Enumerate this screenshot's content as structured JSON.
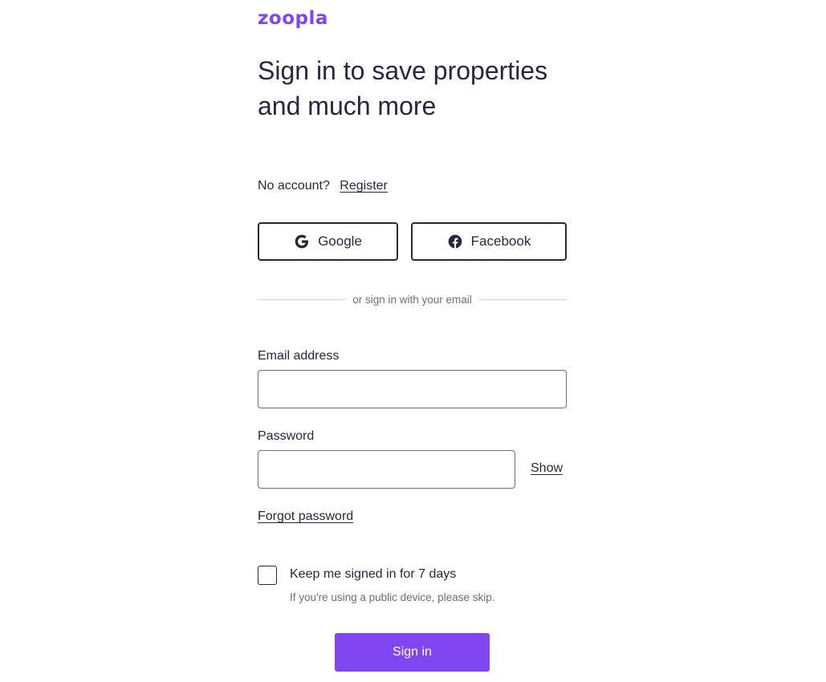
{
  "brand": {
    "logo_text": "zoopla",
    "accent_color": "#8046f1"
  },
  "headline": "Sign in to save properties and much more",
  "register_prompt": {
    "text": "No account?",
    "link": "Register"
  },
  "social": {
    "google": {
      "label": "Google",
      "icon": "google-icon"
    },
    "facebook": {
      "label": "Facebook",
      "icon": "facebook-icon"
    }
  },
  "divider_text": "or sign in with your email",
  "form": {
    "email": {
      "label": "Email address",
      "value": "",
      "placeholder": ""
    },
    "password": {
      "label": "Password",
      "value": "",
      "placeholder": "",
      "show_label": "Show"
    },
    "forgot_link": "Forgot password",
    "keep_signed_in": {
      "label": "Keep me signed in for 7 days",
      "hint": "If you're using a public device, please skip.",
      "checked": false
    },
    "submit_label": "Sign in"
  }
}
